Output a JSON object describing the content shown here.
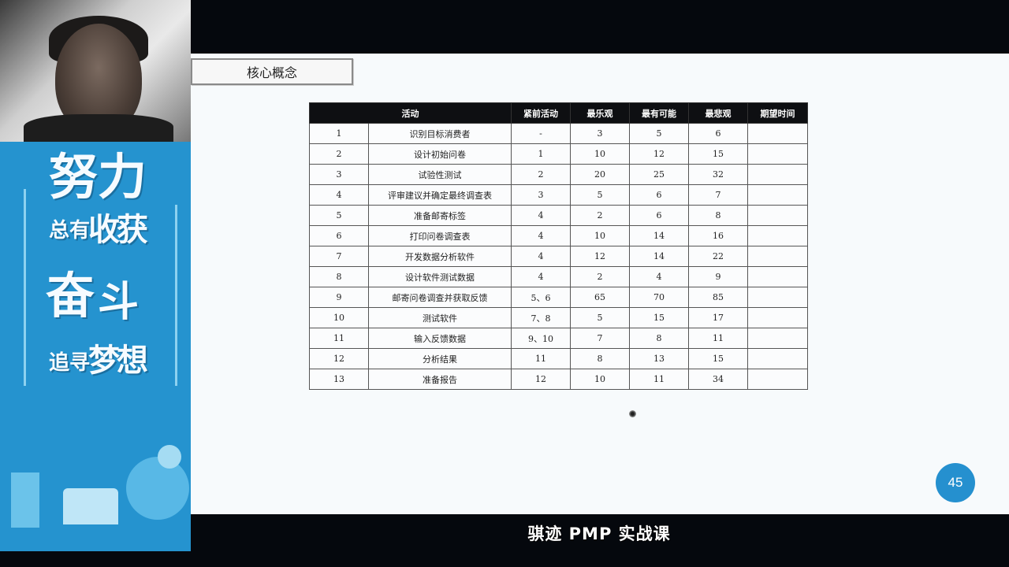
{
  "slide": {
    "concept_label": "核心概念",
    "page_number": "45"
  },
  "caption": "骐迹 PMP 实战课",
  "poster": {
    "chars": {
      "nu": "努",
      "li": "力",
      "zongyou": "总有",
      "shou": "收",
      "huo": "获",
      "fen": "奋",
      "dou": "斗",
      "zhuixun": "追寻",
      "meng": "梦",
      "xiang": "想"
    }
  },
  "table": {
    "headers": [
      "活动",
      "紧前活动",
      "最乐观",
      "最有可能",
      "最悲观",
      "期望时间"
    ],
    "rows": [
      [
        "1",
        "识别目标消费者",
        "-",
        "3",
        "5",
        "6",
        ""
      ],
      [
        "2",
        "设计初始问卷",
        "1",
        "10",
        "12",
        "15",
        ""
      ],
      [
        "3",
        "试验性测试",
        "2",
        "20",
        "25",
        "32",
        ""
      ],
      [
        "4",
        "评审建议并确定最终调查表",
        "3",
        "5",
        "6",
        "7",
        ""
      ],
      [
        "5",
        "准备邮寄标签",
        "4",
        "2",
        "6",
        "8",
        ""
      ],
      [
        "6",
        "打印问卷调查表",
        "4",
        "10",
        "14",
        "16",
        ""
      ],
      [
        "7",
        "开发数据分析软件",
        "4",
        "12",
        "14",
        "22",
        ""
      ],
      [
        "8",
        "设计软件测试数据",
        "4",
        "2",
        "4",
        "9",
        ""
      ],
      [
        "9",
        "邮寄问卷调查并获取反馈",
        "5、6",
        "65",
        "70",
        "85",
        ""
      ],
      [
        "10",
        "测试软件",
        "7、8",
        "5",
        "15",
        "17",
        ""
      ],
      [
        "11",
        "输入反馈数据",
        "9、10",
        "7",
        "8",
        "11",
        ""
      ],
      [
        "12",
        "分析结果",
        "11",
        "8",
        "13",
        "15",
        ""
      ],
      [
        "13",
        "准备报告",
        "12",
        "10",
        "11",
        "34",
        ""
      ]
    ]
  },
  "colors": {
    "accent_blue": "#2590cf",
    "table_header_bg": "#0e0f12",
    "slide_bg": "#f7fafc"
  }
}
